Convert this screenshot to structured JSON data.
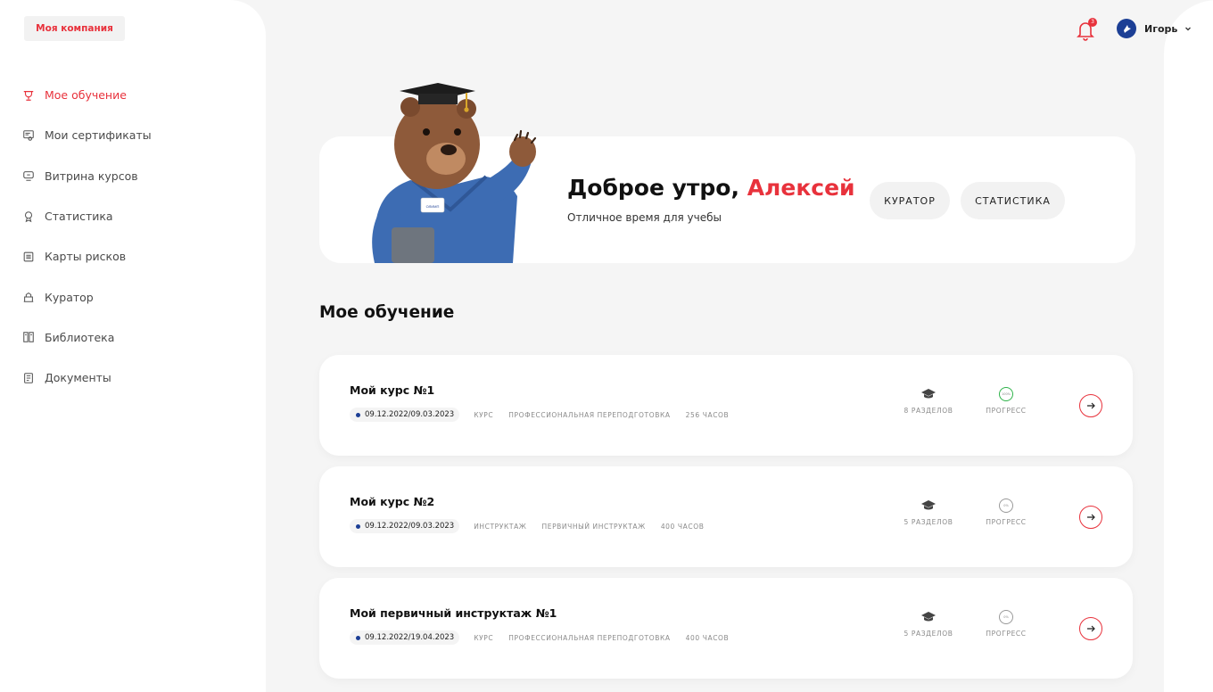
{
  "company": {
    "label": "Моя компания"
  },
  "nav": [
    {
      "label": "Мое обучение",
      "icon": "graduation-icon",
      "active": true
    },
    {
      "label": "Мои сертификаты",
      "icon": "certificate-icon"
    },
    {
      "label": "Витрина курсов",
      "icon": "showcase-icon"
    },
    {
      "label": "Статистика",
      "icon": "statistics-icon"
    },
    {
      "label": "Карты рисков",
      "icon": "risk-map-icon"
    },
    {
      "label": "Куратор",
      "icon": "curator-icon"
    },
    {
      "label": "Библиотека",
      "icon": "library-icon"
    },
    {
      "label": "Документы",
      "icon": "documents-icon"
    }
  ],
  "header": {
    "notifications_count": "3",
    "user_name": "Игорь"
  },
  "welcome": {
    "greeting": "Доброе утро,",
    "name": "Алексей",
    "subtitle": "Отличное время для учебы",
    "curator_button": "КУРАТОР",
    "stats_button": "СТАТИСТИКА",
    "badge_text": "ОЛИМП"
  },
  "section": {
    "title": "Мое обучение"
  },
  "courses": [
    {
      "title": "Мой курс №1",
      "dates": "09.12.2022/09.03.2023",
      "tags": [
        "КУРС",
        "ПРОФЕССИОНАЛЬНАЯ ПЕРЕПОДГОТОВКА",
        "256 ЧАСОВ"
      ],
      "sections": "8 РАЗДЕЛОВ",
      "progress_label": "ПРОГРЕСС",
      "progress_value": "100%",
      "completed": true
    },
    {
      "title": "Мой курс №2",
      "dates": "09.12.2022/09.03.2023",
      "tags": [
        "ИНСТРУКТАЖ",
        "ПЕРВИЧНЫЙ ИНСТРУКТАЖ",
        "400 ЧАСОВ"
      ],
      "sections": "5 РАЗДЕЛОВ",
      "progress_label": "ПРОГРЕСС",
      "progress_value": "0%",
      "completed": false
    },
    {
      "title": "Мой первичный инструктаж №1",
      "dates": "09.12.2022/19.04.2023",
      "tags": [
        "КУРС",
        "ПРОФЕССИОНАЛЬНАЯ ПЕРЕПОДГОТОВКА",
        "400 ЧАСОВ"
      ],
      "sections": "5 РАЗДЕЛОВ",
      "progress_label": "ПРОГРЕСС",
      "progress_value": "0%",
      "completed": false
    }
  ],
  "colors": {
    "accent": "#e8323c",
    "brand_blue": "#1c3f95",
    "success": "#2fb34a"
  }
}
